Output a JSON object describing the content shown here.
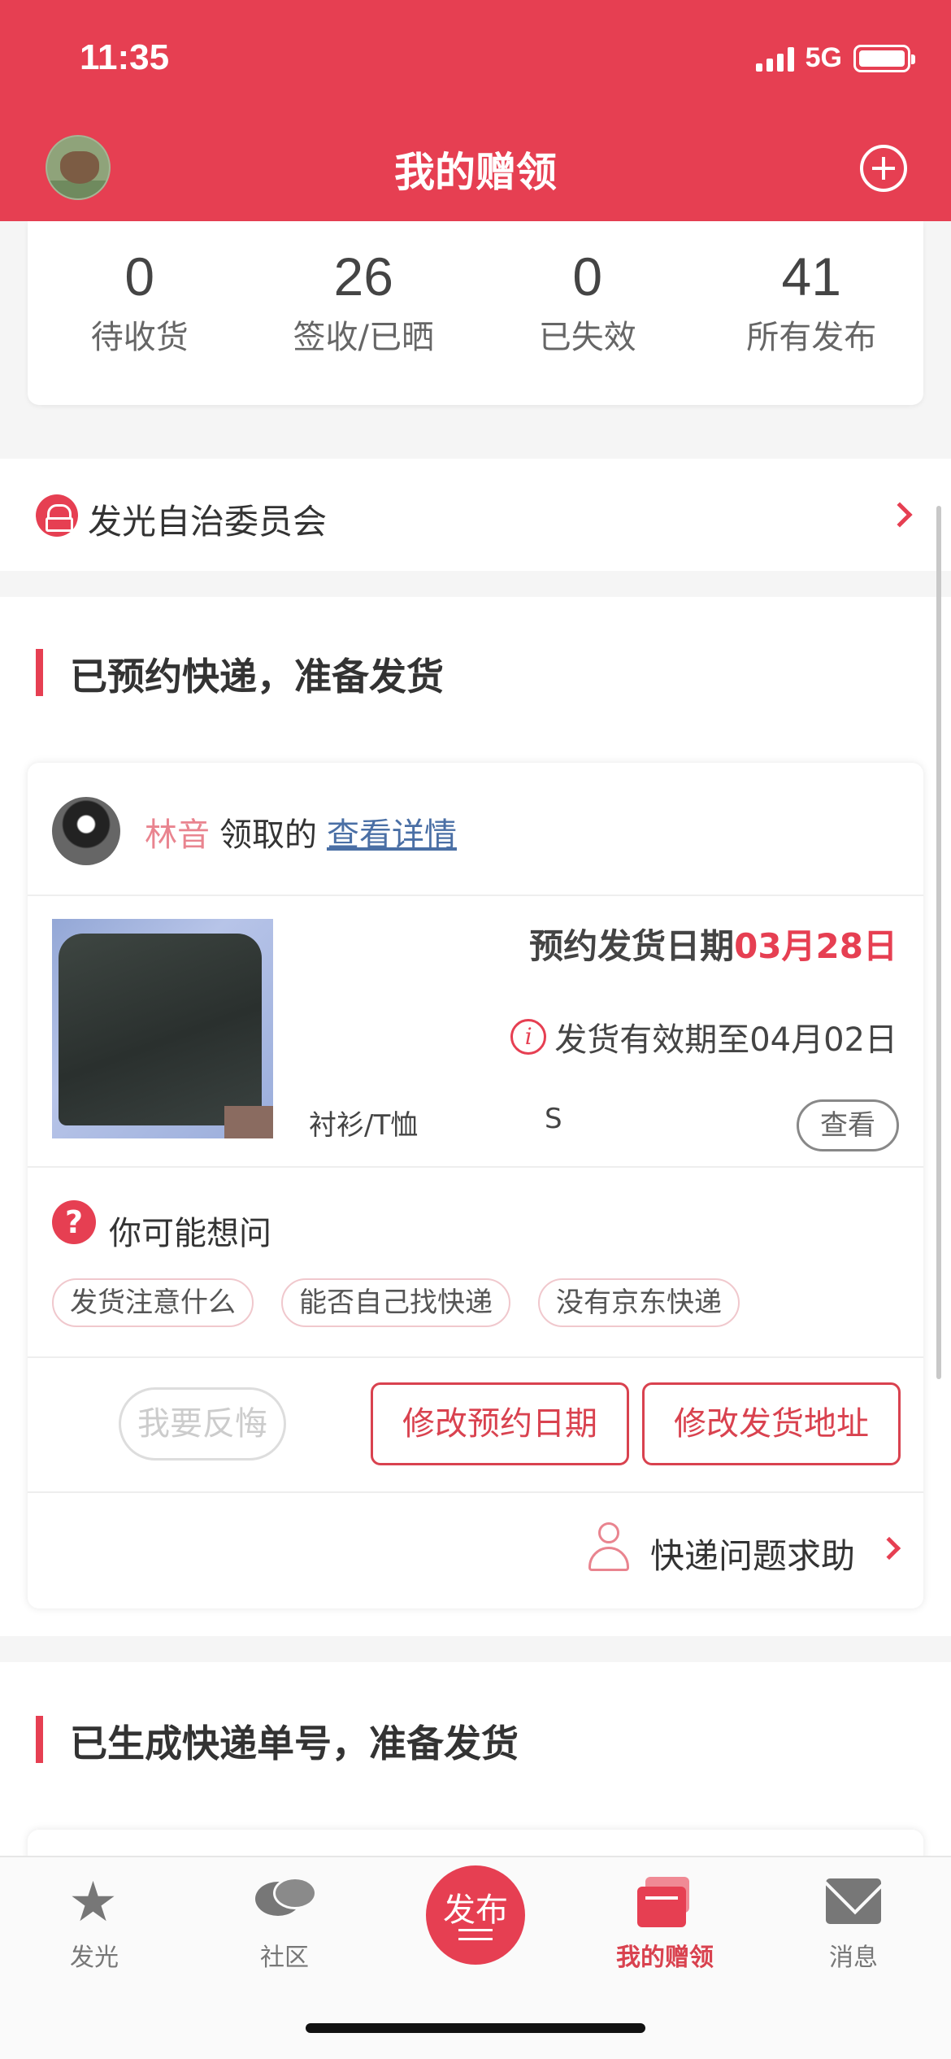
{
  "status_bar": {
    "time": "11:35",
    "network": "5G"
  },
  "header": {
    "title": "我的赠领"
  },
  "stats": [
    {
      "value": "0",
      "label": "待收货"
    },
    {
      "value": "26",
      "label": "签收/已晒"
    },
    {
      "value": "0",
      "label": "已失效"
    },
    {
      "value": "41",
      "label": "所有发布"
    }
  ],
  "committee": {
    "label": "发光自治委员会"
  },
  "section1": {
    "title": "已预约快递，准备发货",
    "order": {
      "receiver_name": "林音",
      "receiver_action": "领取的",
      "detail_link": "查看详情",
      "ship_date_label": "预约发货日期",
      "ship_date_value": "03月28日",
      "valid_text": "发货有效期至04月02日",
      "category": "衬衫/T恤",
      "size": "S",
      "view_label": "查看"
    },
    "faq": {
      "title": "你可能想问",
      "chips": [
        "发货注意什么",
        "能否自己找快递",
        "没有京东快递"
      ]
    },
    "actions": {
      "regret": "我要反悔",
      "edit_date": "修改预约日期",
      "edit_address": "修改发货地址"
    },
    "help": {
      "label": "快递问题求助"
    }
  },
  "section2": {
    "title": "已生成快递单号，准备发货"
  },
  "tabbar": {
    "items": [
      {
        "label": "发光",
        "icon": "star-icon"
      },
      {
        "label": "社区",
        "icon": "chat-icon"
      },
      {
        "label": "发布",
        "icon": "publish-icon"
      },
      {
        "label": "我的赠领",
        "icon": "gift-icon",
        "active": true
      },
      {
        "label": "消息",
        "icon": "mail-icon"
      }
    ]
  },
  "colors": {
    "brand": "#e63f52",
    "accent_pink": "#e9848f",
    "link": "#4a6fa5"
  }
}
